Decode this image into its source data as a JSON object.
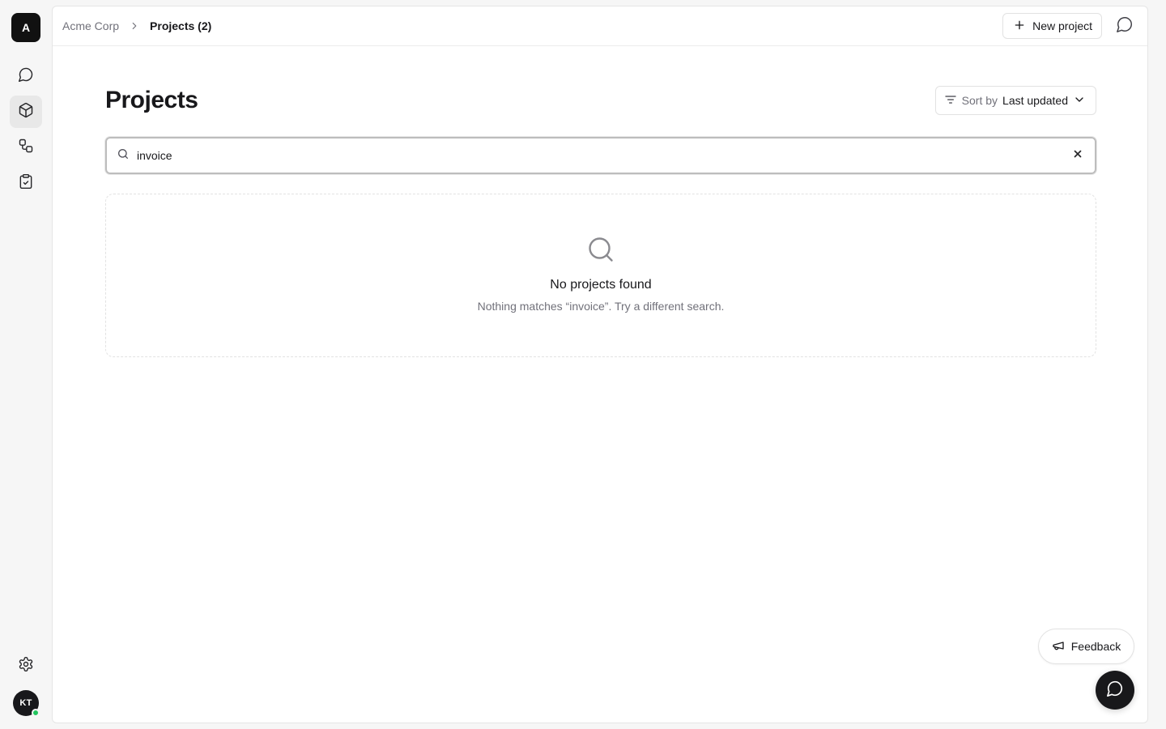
{
  "org": {
    "initial": "A"
  },
  "breadcrumb": {
    "root": "Acme Corp",
    "current": "Projects (2)"
  },
  "toolbar": {
    "new_project_label": "New project"
  },
  "page": {
    "title": "Projects"
  },
  "sort": {
    "label": "Sort by",
    "value": "Last updated"
  },
  "search": {
    "value": "invoice"
  },
  "empty": {
    "title": "No projects found",
    "description": "Nothing matches “invoice”. Try a different search."
  },
  "user": {
    "initials": "KT",
    "status_color": "#22c55e"
  },
  "feedback": {
    "label": "Feedback"
  },
  "nav": {
    "items": [
      {
        "icon": "chat-icon"
      },
      {
        "icon": "box-icon",
        "active": true
      },
      {
        "icon": "workflow-icon"
      },
      {
        "icon": "clipboard-check-icon"
      }
    ]
  }
}
